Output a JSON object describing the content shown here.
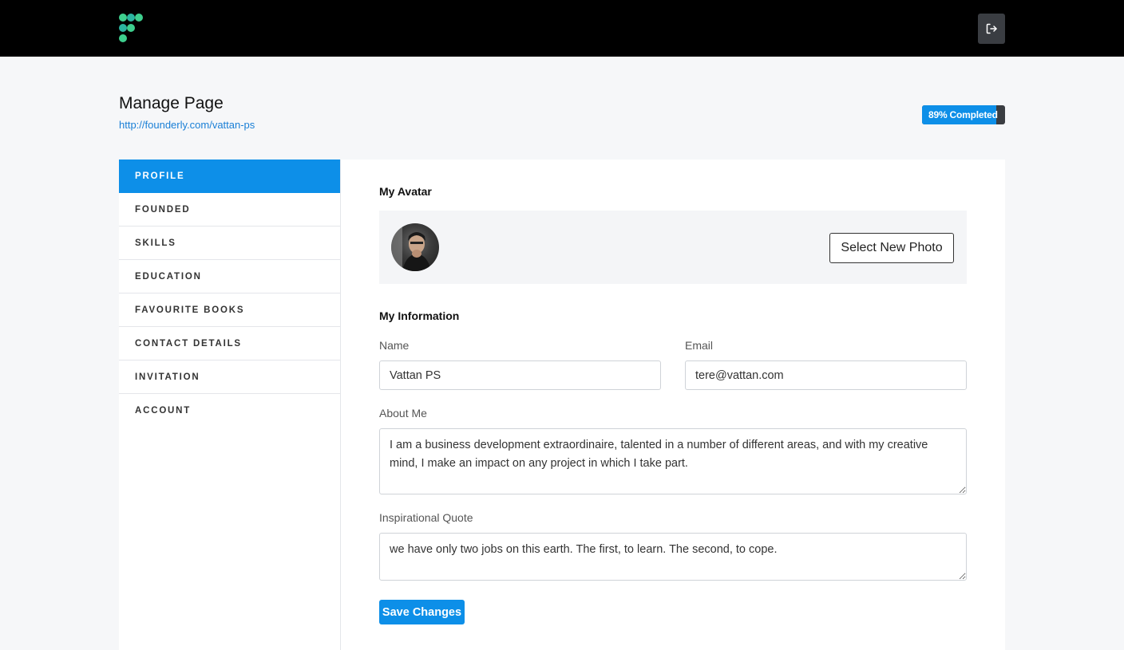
{
  "header": {
    "logo_icon": "founderly-logo-icon",
    "logout_icon": "logout-icon",
    "colors": {
      "bar": "#000000",
      "logo_green": "#3ecf8e",
      "logo_teal": "#2bb5a0"
    }
  },
  "page": {
    "title": "Manage Page",
    "url": "http://founderly.com/vattan-ps",
    "progress_label": "89% Completed",
    "progress_value": 0.89
  },
  "sidebar": {
    "items": [
      {
        "label": "PROFILE",
        "active": true
      },
      {
        "label": "FOUNDED"
      },
      {
        "label": "SKILLS"
      },
      {
        "label": "EDUCATION"
      },
      {
        "label": "FAVOURITE BOOKS"
      },
      {
        "label": "CONTACT DETAILS"
      },
      {
        "label": "INVITATION"
      },
      {
        "label": "ACCOUNT"
      }
    ]
  },
  "profile": {
    "avatar_title": "My Avatar",
    "select_photo_label": "Select New Photo",
    "info_title": "My Information",
    "name_label": "Name",
    "name_value": "Vattan PS",
    "email_label": "Email",
    "email_value": "tere@vattan.com",
    "about_label": "About Me",
    "about_value": "I am a business development extraordinaire, talented in a number of different areas, and with my creative mind, I make an impact on any project in which I take part.",
    "quote_label": "Inspirational Quote",
    "quote_value": "we have only two jobs on this earth. The first, to learn. The second, to cope.",
    "save_label": "Save Changes"
  },
  "accent_color": "#0d8fe8"
}
